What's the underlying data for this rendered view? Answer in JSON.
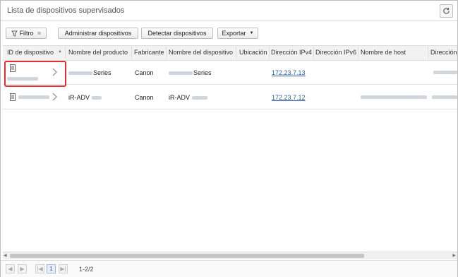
{
  "window": {
    "title": "Lista de dispositivos supervisados"
  },
  "toolbar": {
    "filter_label": "Filtro",
    "manage_label": "Administrar dispositivos",
    "detect_label": "Detectar dispositivos",
    "export_label": "Exportar"
  },
  "columns": [
    "ID de dispositivo",
    "Nombre del producto",
    "Fabricante",
    "Nombre del dispositivo",
    "Ubicación",
    "Dirección IPv4",
    "Dirección IPv6",
    "Nombre de host",
    "Dirección"
  ],
  "rows": [
    {
      "product": "Series",
      "manufacturer": "Canon",
      "device_name": "Series",
      "ipv4": "172.23.7.13"
    },
    {
      "product": "iR-ADV",
      "manufacturer": "Canon",
      "device_name": "iR-ADV",
      "ipv4": "172.23.7.12"
    }
  ],
  "pager": {
    "page": "1",
    "range": "1-2/2"
  },
  "icons": {
    "refresh": "refresh-icon",
    "filter": "filter-icon",
    "device": "device-icon",
    "expand": "chevron-right-icon",
    "sort": "sort-asc-icon"
  },
  "colors": {
    "highlight": "#e03030",
    "link": "#2a5d9f"
  }
}
